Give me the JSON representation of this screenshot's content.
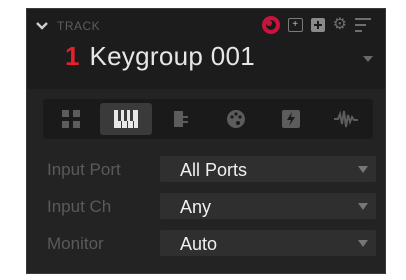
{
  "header": {
    "section_label": "TRACK",
    "track_number": "1",
    "track_name": "Keygroup 001",
    "icons": [
      "record-arm-icon",
      "add-clip-icon",
      "add-track-icon",
      "settings-icon",
      "menu-icon"
    ],
    "record_color": "#c8143b",
    "number_color": "#e8202c"
  },
  "track_types": {
    "items": [
      {
        "name": "grid-icon",
        "active": false
      },
      {
        "name": "piano-keys-icon",
        "active": true
      },
      {
        "name": "plugin-icon",
        "active": false
      },
      {
        "name": "palette-icon",
        "active": false
      },
      {
        "name": "lightning-icon",
        "active": false
      },
      {
        "name": "waveform-icon",
        "active": false
      }
    ]
  },
  "settings": [
    {
      "label": "Input Port",
      "value": "All Ports"
    },
    {
      "label": "Input Ch",
      "value": "Any"
    },
    {
      "label": "Monitor",
      "value": "Auto"
    }
  ]
}
